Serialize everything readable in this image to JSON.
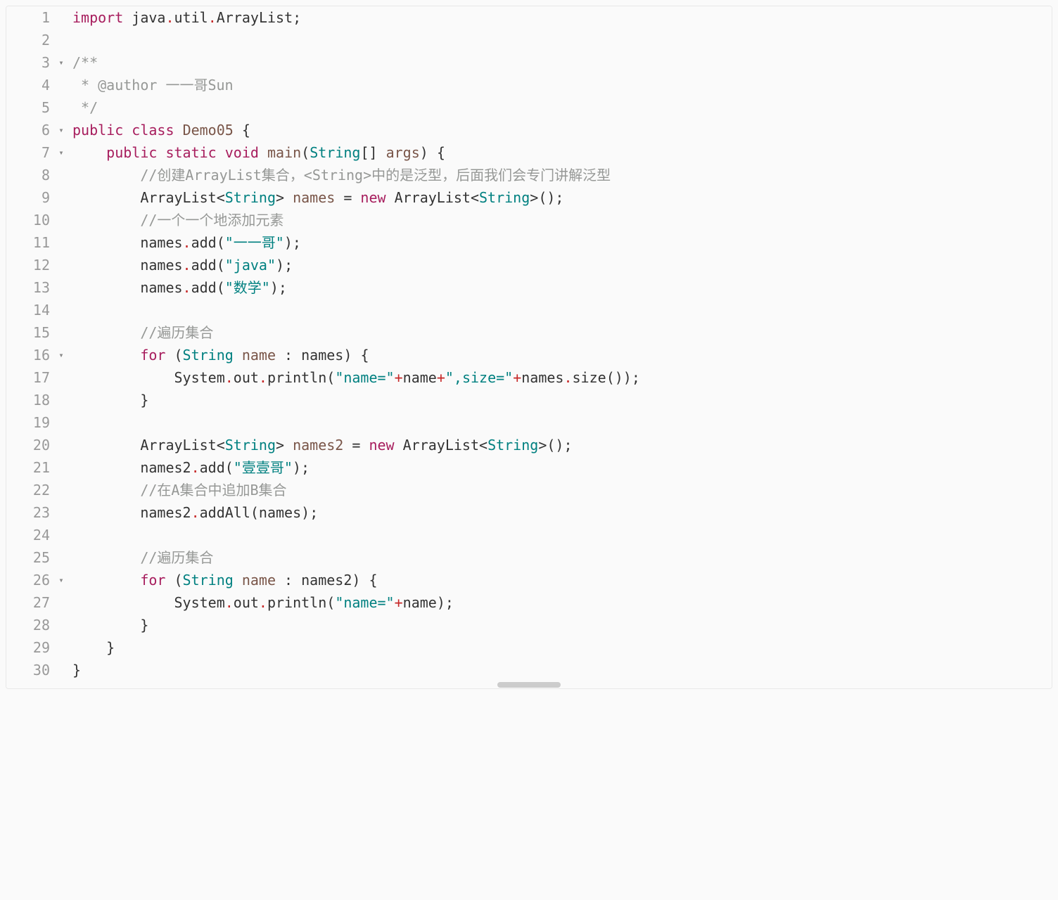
{
  "lines": [
    {
      "num": "1",
      "fold": ""
    },
    {
      "num": "2",
      "fold": ""
    },
    {
      "num": "3",
      "fold": "▾"
    },
    {
      "num": "4",
      "fold": ""
    },
    {
      "num": "5",
      "fold": ""
    },
    {
      "num": "6",
      "fold": "▾"
    },
    {
      "num": "7",
      "fold": "▾"
    },
    {
      "num": "8",
      "fold": ""
    },
    {
      "num": "9",
      "fold": ""
    },
    {
      "num": "10",
      "fold": ""
    },
    {
      "num": "11",
      "fold": ""
    },
    {
      "num": "12",
      "fold": ""
    },
    {
      "num": "13",
      "fold": ""
    },
    {
      "num": "14",
      "fold": ""
    },
    {
      "num": "15",
      "fold": ""
    },
    {
      "num": "16",
      "fold": "▾"
    },
    {
      "num": "17",
      "fold": ""
    },
    {
      "num": "18",
      "fold": ""
    },
    {
      "num": "19",
      "fold": ""
    },
    {
      "num": "20",
      "fold": ""
    },
    {
      "num": "21",
      "fold": ""
    },
    {
      "num": "22",
      "fold": ""
    },
    {
      "num": "23",
      "fold": ""
    },
    {
      "num": "24",
      "fold": ""
    },
    {
      "num": "25",
      "fold": ""
    },
    {
      "num": "26",
      "fold": "▾"
    },
    {
      "num": "27",
      "fold": ""
    },
    {
      "num": "28",
      "fold": ""
    },
    {
      "num": "29",
      "fold": ""
    },
    {
      "num": "30",
      "fold": ""
    }
  ],
  "code": {
    "l1": {
      "kw_import": "import",
      "p1": " java",
      "d1": ".",
      "p2": "util",
      "d2": ".",
      "p3": "ArrayList",
      "semi": ";"
    },
    "l3": {
      "c": "/**"
    },
    "l4": {
      "c": " * @author 一一哥Sun"
    },
    "l5": {
      "c": " */"
    },
    "l6": {
      "kw_public": "public",
      "kw_class": "class",
      "name": "Demo05",
      "brace": " {"
    },
    "l7": {
      "kw_public": "public",
      "kw_static": "static",
      "kw_void": "void",
      "method": "main",
      "paren_o": "(",
      "type": "String",
      "brackets": "[]",
      "arg": " args",
      "paren_c": ")",
      "brace": " {"
    },
    "l8": {
      "c": "//创建ArrayList集合，<String>中的是泛型，后面我们会专门讲解泛型"
    },
    "l9": {
      "type1": "ArrayList",
      "lt1": "<",
      "type2": "String",
      "gt1": ">",
      "var": " names",
      "eq": " = ",
      "kw_new": "new",
      "type3": " ArrayList",
      "lt2": "<",
      "type4": "String",
      "gt2": ">",
      "parens": "()",
      "semi": ";"
    },
    "l10": {
      "c": "//一个一个地添加元素"
    },
    "l11": {
      "obj": "names",
      "d": ".",
      "method": "add",
      "paren_o": "(",
      "str": "\"一一哥\"",
      "paren_c": ")",
      "semi": ";"
    },
    "l12": {
      "obj": "names",
      "d": ".",
      "method": "add",
      "paren_o": "(",
      "str": "\"java\"",
      "paren_c": ")",
      "semi": ";"
    },
    "l13": {
      "obj": "names",
      "d": ".",
      "method": "add",
      "paren_o": "(",
      "str": "\"数学\"",
      "paren_c": ")",
      "semi": ";"
    },
    "l15": {
      "c": "//遍历集合"
    },
    "l16": {
      "kw_for": "for",
      "paren_o": " (",
      "type": "String",
      "var": " name",
      "colon": " : ",
      "coll": "names",
      "paren_c": ")",
      "brace": " {"
    },
    "l17": {
      "sys": "System",
      "d1": ".",
      "out": "out",
      "d2": ".",
      "method": "println",
      "paren_o": "(",
      "str1": "\"name=\"",
      "plus1": "+",
      "var1": "name",
      "plus2": "+",
      "str2": "\",size=\"",
      "plus3": "+",
      "obj": "names",
      "d3": ".",
      "m2": "size",
      "parens": "()",
      "paren_c": ")",
      "semi": ";"
    },
    "l18": {
      "brace": "}"
    },
    "l20": {
      "type1": "ArrayList",
      "lt1": "<",
      "type2": "String",
      "gt1": ">",
      "var": " names2",
      "eq": " = ",
      "kw_new": "new",
      "type3": " ArrayList",
      "lt2": "<",
      "type4": "String",
      "gt2": ">",
      "parens": "()",
      "semi": ";"
    },
    "l21": {
      "obj": "names2",
      "d": ".",
      "method": "add",
      "paren_o": "(",
      "str": "\"壹壹哥\"",
      "paren_c": ")",
      "semi": ";"
    },
    "l22": {
      "c": "//在A集合中追加B集合"
    },
    "l23": {
      "obj": "names2",
      "d": ".",
      "method": "addAll",
      "paren_o": "(",
      "arg": "names",
      "paren_c": ")",
      "semi": ";"
    },
    "l25": {
      "c": "//遍历集合"
    },
    "l26": {
      "kw_for": "for",
      "paren_o": " (",
      "type": "String",
      "var": " name",
      "colon": " : ",
      "coll": "names2",
      "paren_c": ")",
      "brace": " {"
    },
    "l27": {
      "sys": "System",
      "d1": ".",
      "out": "out",
      "d2": ".",
      "method": "println",
      "paren_o": "(",
      "str1": "\"name=\"",
      "plus1": "+",
      "var1": "name",
      "paren_c": ")",
      "semi": ";"
    },
    "l28": {
      "brace": "}"
    },
    "l29": {
      "brace": "}"
    },
    "l30": {
      "brace": "}"
    }
  }
}
